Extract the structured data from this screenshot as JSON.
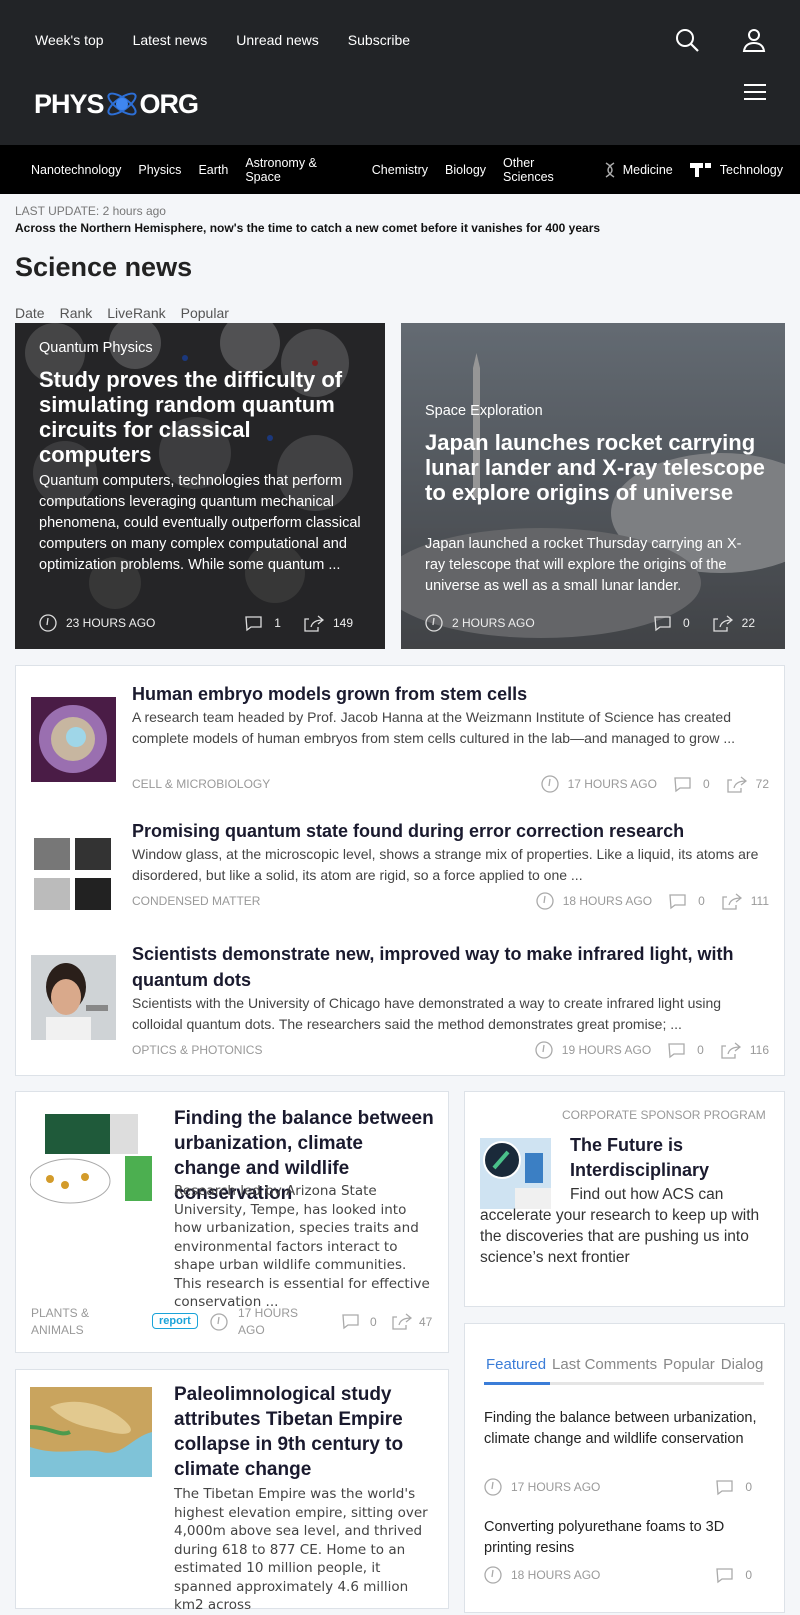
{
  "topnav": [
    "Week's top",
    "Latest news",
    "Unread news",
    "Subscribe"
  ],
  "logo": {
    "left": "PHYS",
    "right": "ORG"
  },
  "categories": [
    "Nanotechnology",
    "Physics",
    "Earth",
    "Astronomy & Space",
    "Chemistry",
    "Biology",
    "Other Sciences",
    "Medicine",
    "Technology"
  ],
  "last_update": "LAST UPDATE: 2 hours ago",
  "headline": "Across the Northern Hemisphere, now's the time to catch a new comet before it vanishes for 400 years",
  "page_title": "Science news",
  "sort_tabs": [
    "Date",
    "Rank",
    "LiveRank",
    "Popular"
  ],
  "hero": [
    {
      "category": "Quantum Physics",
      "title": "Study proves the difficulty of simulating random quantum circuits for classical computers",
      "desc": "Quantum computers, technologies that perform computations leveraging quantum mechanical phenomena, could eventually outperform classical computers on many complex computational and optimization problems. While some quantum ...",
      "time": "23 HOURS AGO",
      "comments": "1",
      "shares": "149"
    },
    {
      "category": "Space Exploration",
      "title": "Japan launches rocket carrying lunar lander and X-ray telescope to explore origins of universe",
      "desc": "Japan launched a rocket Thursday carrying an X-ray telescope that will explore the origins of the universe as well as a small lunar lander.",
      "time": "2 HOURS AGO",
      "comments": "0",
      "shares": "22"
    }
  ],
  "articles": [
    {
      "title": "Human embryo models grown from stem cells",
      "desc": "A research team headed by Prof. Jacob Hanna at the Weizmann Institute of Science has created complete models of human embryos from stem cells cultured in the lab—and managed to grow ...",
      "category": "CELL & MICROBIOLOGY",
      "time": "17 HOURS AGO",
      "comments": "0",
      "shares": "72"
    },
    {
      "title": "Promising quantum state found during error correction research",
      "desc": "Window glass, at the microscopic level, shows a strange mix of properties. Like a liquid, its atoms are disordered, but like a solid, its atom are rigid, so a force applied to one ...",
      "category": "CONDENSED MATTER",
      "time": "18 HOURS AGO",
      "comments": "0",
      "shares": "111"
    },
    {
      "title": "Scientists demonstrate new, improved way to make infrared light, with quantum dots",
      "desc": "Scientists with the University of Chicago have demonstrated a way to create infrared light using colloidal quantum dots. The researchers said the method demonstrates great promise; ...",
      "category": "OPTICS & PHOTONICS",
      "time": "19 HOURS AGO",
      "comments": "0",
      "shares": "116"
    }
  ],
  "card1": {
    "title": "Finding the balance between urbanization, climate change and wildlife conservation",
    "desc": "Research led by Arizona State University, Tempe, has looked into how urbanization, species traits and environmental factors interact to shape urban wildlife communities. This research is essential for effective conservation ...",
    "category": "PLANTS & ANIMALS",
    "badge": "report",
    "time": "17 HOURS AGO",
    "comments": "0",
    "shares": "47"
  },
  "card2": {
    "title": "Paleolimnological study attributes Tibetan Empire collapse in 9th century to climate change",
    "desc": "The Tibetan Empire was the world's highest elevation empire, sitting over 4,000m above sea level, and thrived during 618 to 877 CE. Home to an estimated 10 million people, it spanned approximately 4.6 million km2 across"
  },
  "sponsor": {
    "label": "CORPORATE SPONSOR PROGRAM",
    "title": "The Future is Interdisciplinary",
    "desc": "Find out how ACS can accelerate your research to keep up with the discoveries that are pushing us into science’s next frontier"
  },
  "featured": {
    "tabs": [
      "Featured",
      "Last Comments",
      "Popular",
      "Dialog"
    ],
    "items": [
      {
        "title": "Finding the balance between urbanization, climate change and wildlife conservation",
        "time": "17 HOURS AGO",
        "comments": "0"
      },
      {
        "title": "Converting polyurethane foams to 3D printing resins",
        "time": "18 HOURS AGO",
        "comments": "0"
      }
    ]
  },
  "colors": {
    "header": "#222427",
    "catbar": "#000000",
    "accent": "#3b7dd8",
    "badge": "#1aa3d9"
  },
  "icons": {
    "search": "search-icon",
    "user": "user-icon",
    "menu": "menu-icon",
    "clock": "clock-icon",
    "comment": "comment-icon",
    "share": "share-icon"
  }
}
